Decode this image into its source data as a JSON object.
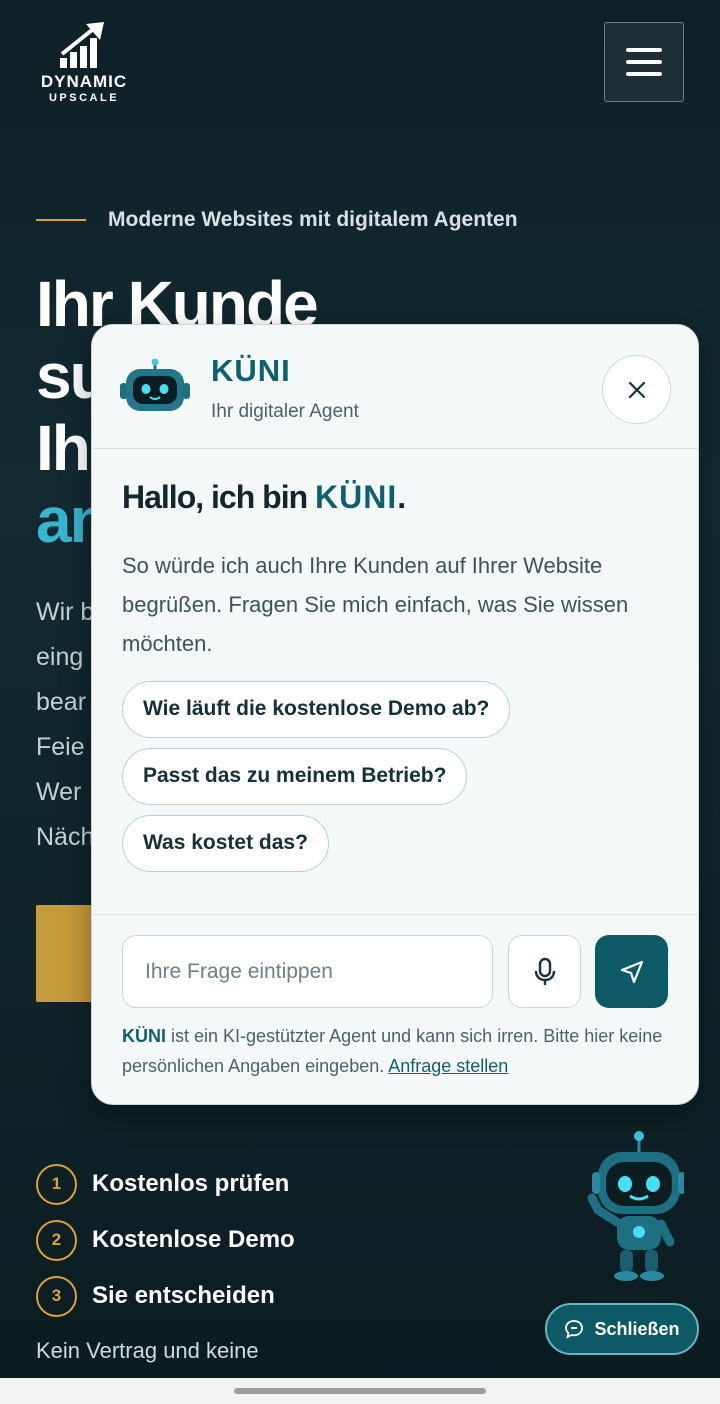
{
  "header": {
    "logo_line1": "DYNAMIC",
    "logo_line2": "UPSCALE",
    "menu_icon": "hamburger-icon"
  },
  "hero": {
    "eyebrow": "Moderne Websites mit digitalem Agenten",
    "title_line1": "Ihr Kunde",
    "title_line2": "su",
    "title_line3": "Ihr",
    "title_line4_accent": "an",
    "text_lines": [
      "Wir b",
      "eing",
      "bear",
      "Feie",
      "Wer",
      "Näch"
    ]
  },
  "steps": [
    {
      "num": "1",
      "label": "Kostenlos prüfen"
    },
    {
      "num": "2",
      "label": "Kostenlose Demo"
    },
    {
      "num": "3",
      "label": "Sie entscheiden"
    }
  ],
  "footnote": "Kein Vertrag und keine",
  "chat": {
    "name": "KÜNI",
    "subtitle": "Ihr digitaler Agent",
    "greeting_prefix": "Hallo, ich bin ",
    "greeting_name": "KÜNI",
    "greeting_suffix": ".",
    "intro": "So würde ich auch Ihre Kunden auf Ihrer Website begrüßen. Fragen Sie mich einfach, was Sie wissen möchten.",
    "suggestions": [
      "Wie läuft die kostenlose Demo ab?",
      "Passt das zu meinem Betrieb?",
      "Was kostet das?"
    ],
    "input_placeholder": "Ihre Frage eintippen",
    "disclaimer_name": "KÜNI",
    "disclaimer_text": " ist ein KI-gestützter Agent und kann sich irren. Bitte hier keine persönlichen Angaben eingeben. ",
    "disclaimer_link": "Anfrage stellen"
  },
  "close_button_label": "Schließen",
  "colors": {
    "accent_teal": "#0f5f6e",
    "gold": "#d8a33d",
    "cyan": "#37b6cf",
    "background": "#132a31"
  }
}
